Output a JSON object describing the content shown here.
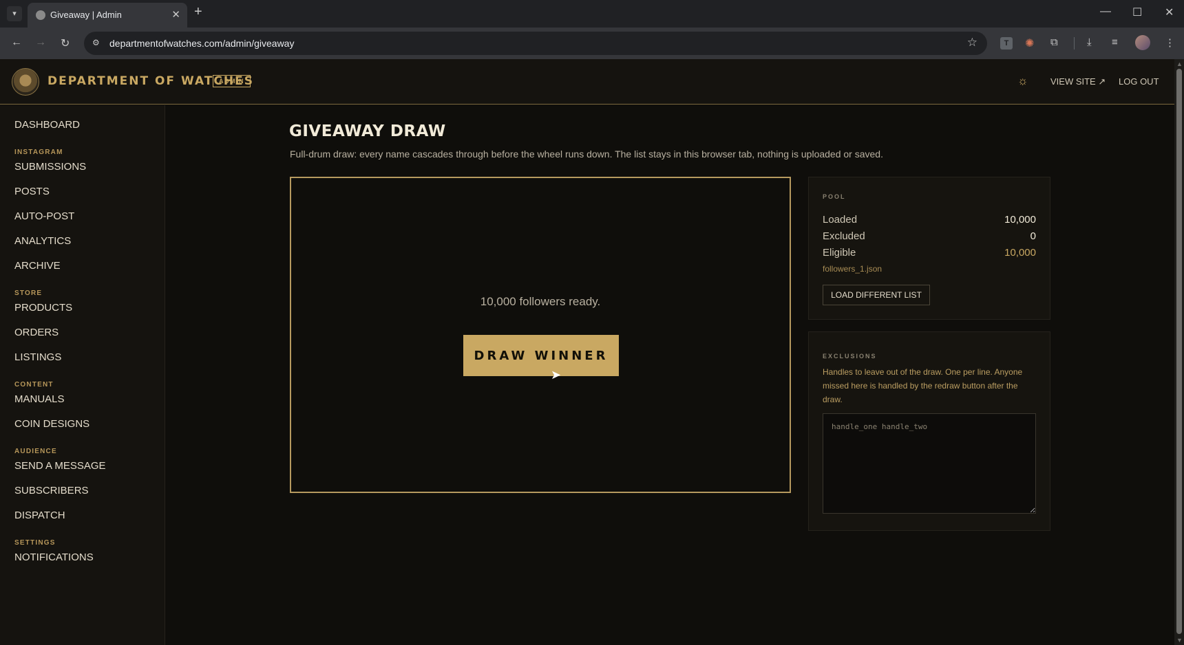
{
  "browser": {
    "tab_title": "Giveaway | Admin",
    "url": "departmentofwatches.com/admin/giveaway",
    "extension_letter": "T"
  },
  "header": {
    "brand": "DEPARTMENT OF WATCHES",
    "badge": "ADMIN",
    "view_site": "VIEW SITE ↗",
    "log_out": "LOG OUT"
  },
  "sidebar": {
    "dashboard": "DASHBOARD",
    "sections": {
      "instagram": "INSTAGRAM",
      "store": "STORE",
      "content": "CONTENT",
      "audience": "AUDIENCE",
      "settings": "SETTINGS"
    },
    "items": {
      "submissions": "SUBMISSIONS",
      "posts": "POSTS",
      "auto_post": "AUTO-POST",
      "analytics": "ANALYTICS",
      "archive": "ARCHIVE",
      "products": "PRODUCTS",
      "orders": "ORDERS",
      "listings": "LISTINGS",
      "manuals": "MANUALS",
      "coin_designs": "COIN DESIGNS",
      "send_message": "SEND A MESSAGE",
      "subscribers": "SUBSCRIBERS",
      "dispatch": "DISPATCH",
      "notifications": "NOTIFICATIONS"
    }
  },
  "main": {
    "title": "GIVEAWAY DRAW",
    "subtitle": "Full-drum draw: every name cascades through before the wheel runs down. The list stays in this browser tab, nothing is uploaded or saved.",
    "ready_text": "10,000 followers ready.",
    "draw_button": "DRAW WINNER"
  },
  "pool": {
    "label": "POOL",
    "loaded_label": "Loaded",
    "loaded_value": "10,000",
    "excluded_label": "Excluded",
    "excluded_value": "0",
    "eligible_label": "Eligible",
    "eligible_value": "10,000",
    "file": "followers_1.json",
    "load_button": "LOAD DIFFERENT LIST"
  },
  "exclusions": {
    "label": "EXCLUSIONS",
    "help": "Handles to leave out of the draw. One per line. Anyone missed here is handled by the redraw button after the draw.",
    "placeholder": "handle_one handle_two"
  },
  "colors": {
    "accent_gold": "#c9a862",
    "background": "#0f0e0b",
    "panel": "#16140f"
  }
}
